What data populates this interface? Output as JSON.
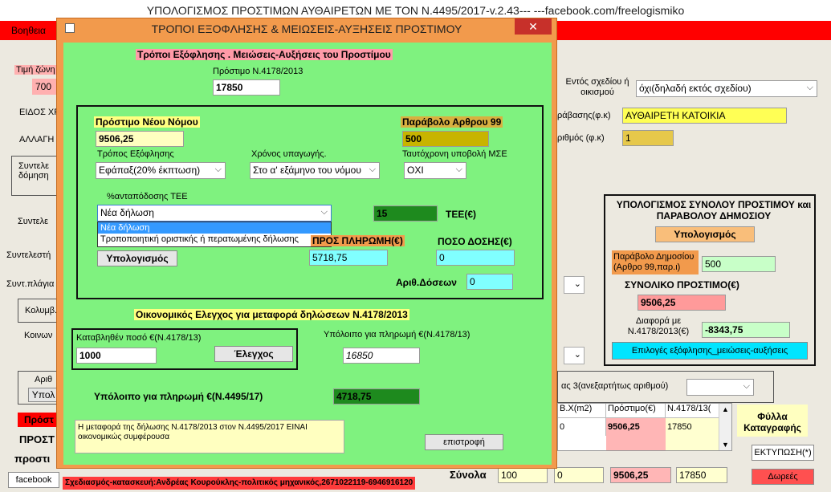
{
  "window": {
    "title": "ΥΠΟΛΟΓΙΣΜΟΣ ΠΡΟΣΤΙΜΩΝ ΑΥΘΑΙΡΕΤΩΝ ΜΕ ΤΟΝ Ν.4495/2017-v.2.43---              ---facebook.com/freelogismiko"
  },
  "menu": {
    "help": "Βοηθεια"
  },
  "background": {
    "zone_price_label": "Τιμή ζώνη",
    "zone_price_value": "700",
    "eidos_label": "ΕΙΔΟΣ ΧΡ",
    "allagi_label": "ΑΛΛΑΓΗ Χ",
    "syntel1_label": "Συντελε δόμηση",
    "syntel2_label": "Συντελε",
    "syntel3_label": "Συντελεστή",
    "synt_plagia_label": "Συντ.πλάγια",
    "kolymv_label": "Κολυμβ.",
    "koinoxr_label": "Κοινων",
    "arith_label": "Αριθ",
    "ypol_btn": "Υπολ",
    "prost_red": "Πρόστ",
    "prost_big": "ΠΡΟΣΤ",
    "prost_small": "προστι",
    "facebook_btn": "facebook",
    "footer_credit": "Σχεδιασμός-κατασκευή:Ανδρέας Κουρούκλης-πολιτικός μηχανικός,2671022119-6946916120",
    "entos_label": "Εντός σχεδίου ή οικισμού",
    "entos_select": "όχι(δηλαδή εκτός σχεδίου)",
    "paravasi_label": "ράβασης(φ.κ)",
    "paravasi_value": "ΑΥΘΑΙΡΕΤΗ ΚΑΤΟΙΚΙΑ",
    "arithmos_label": "ριθμός (φ.κ)",
    "arithmos_value": "1",
    "calc_title": "ΥΠΟΛΟΓΙΣΜΟΣ ΣΥΝΟΛΟΥ ΠΡΟΣΤΙΜΟΥ και ΠΑΡΑΒΟΛΟΥ ΔΗΜΟΣΙΟΥ",
    "calc_btn": "Υπολογισμός",
    "paravolo_label": "Παράβολο Δημοσίου (Αρθρο 99,παρ.ι)",
    "paravolo_value": "500",
    "total_label": "ΣΥΝΟΛΙΚΟ ΠΡΟΣΤΙΜΟ(€)",
    "total_value": "9506,25",
    "diafora_label": "Διαφορά με Ν.4178/2013(€)",
    "diafora_value": "-8343,75",
    "options_btn": "Επιλογές εξόφλησης_μειώσεις-αυξήσεις",
    "aneks_label": "ας 3(ανεξαρτήτως αριθμού)",
    "grid_headers": [
      "Β.Χ(m2)",
      "Πρόστιμο(€)",
      "Ν.4178/13("
    ],
    "grid_row1": [
      "0",
      "9506,25",
      "17850"
    ],
    "synola_label": "Σύνολα",
    "synola_values": [
      "100",
      "0",
      "9506,25",
      "17850"
    ],
    "fylla_label": "Φύλλα Καταγραφής",
    "print_btn": "ΕΚΤΥΠΩΣΗ(*)",
    "dora_btn": "Δωρεές"
  },
  "dialog": {
    "title": "ΤΡΟΠΟΙ ΕΞΟΦΛΗΣΗΣ & ΜΕΙΩΣΕΙΣ-ΑΥΞΗΣΕΙΣ ΠΡΟΣΤΙΜΟΥ",
    "header": "Τρόποι Εξόφλησης . Μειώσεις-Αυξήσεις του Προστίμου",
    "old_fine_label": "Πρόστιμο Ν.4178/2013",
    "old_fine_value": "17850",
    "new_fine_label": "Πρόστιμο Νέου Νόμου",
    "new_fine_value": "9506,25",
    "paravolo_label": "Παράβολο Αρθρου 99",
    "paravolo_value": "500",
    "payment_label": "Τρόπος Εξόφλησης",
    "payment_value": "Εφάπαξ(20% έκπτωση)",
    "year_label": "Χρόνος υπαγωγής.",
    "year_value": "Στο α' εξάμηνο του νόμου",
    "mse_label": "Ταυτόχρονη υποβολή ΜΣΕ",
    "mse_value": "ΟΧΙ",
    "tee_pct_label": "%ανταπόδοσης ΤΕΕ",
    "decl_value": "Νέα δήλωση",
    "decl_options": [
      "Νέα δήλωση",
      "Τροποποιητική οριστικής ή περατωμένης δήλωσης"
    ],
    "tee_value": "15",
    "tee_label": "ΤΕΕ(€)",
    "pay_amount_label": "ΠΡΟΣ ΠΛΗΡΩΜΗ(€)",
    "dose_label": "ΠΟΣΟ ΔΟΣΗΣ(€)",
    "calc_btn": "Υπολογισμός",
    "pay_amount_value": "5718,75",
    "dose_value": "0",
    "doses_label": "Αριθ.Δόσεων",
    "doses_value": "0",
    "econ_header": "Οικονομικός Ελεγχος για μεταφορά δηλώσεων Ν.4178/2013",
    "paid_label": "Καταβληθέν ποσό €(Ν.4178/13)",
    "paid_value": "1000",
    "check_btn": "Έλεγχος",
    "remain_old_label": "Υπόλοιπο για πληρωμή €(Ν.4178/13)",
    "remain_old_value": "16850",
    "remain_new_label": "Υπόλοιπο για πληρωμή €(Ν.4495/17)",
    "remain_new_value": "4718,75",
    "message": "Η μεταφορά της δήλωσης Ν.4178/2013 στον Ν.4495/2017 ΕΙΝΑΙ οικονομικώς συμφέρουσα",
    "back_btn": "επιστροφή"
  }
}
